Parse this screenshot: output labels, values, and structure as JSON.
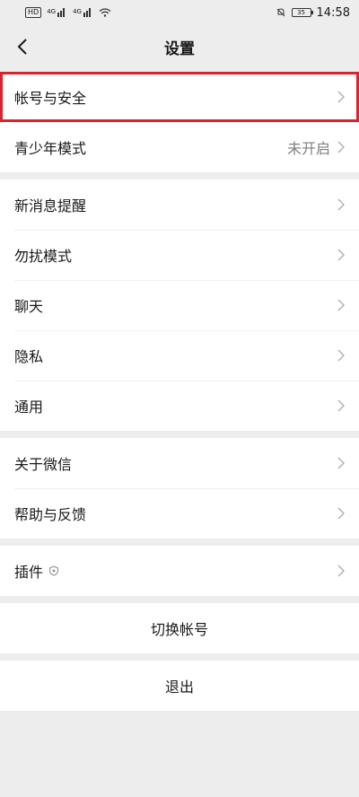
{
  "status_bar": {
    "sim_badge": "HD",
    "sig1_tag": "4G",
    "sig2_tag": "4G",
    "battery": "35",
    "time": "14:58"
  },
  "header": {
    "title": "设置"
  },
  "groups": {
    "account": {
      "account_security": "帐号与安全",
      "youth_mode": "青少年模式",
      "youth_mode_value": "未开启"
    },
    "notify": {
      "new_message": "新消息提醒",
      "dnd": "勿扰模式",
      "chat": "聊天",
      "privacy": "隐私",
      "general": "通用"
    },
    "about": {
      "about_wechat": "关于微信",
      "help_feedback": "帮助与反馈"
    },
    "plugins": {
      "label": "插件"
    }
  },
  "actions": {
    "switch_account": "切换帐号",
    "logout": "退出"
  },
  "colors": {
    "highlight": "#d9232e",
    "background": "#ededed",
    "value_text": "#7f7f7f"
  }
}
